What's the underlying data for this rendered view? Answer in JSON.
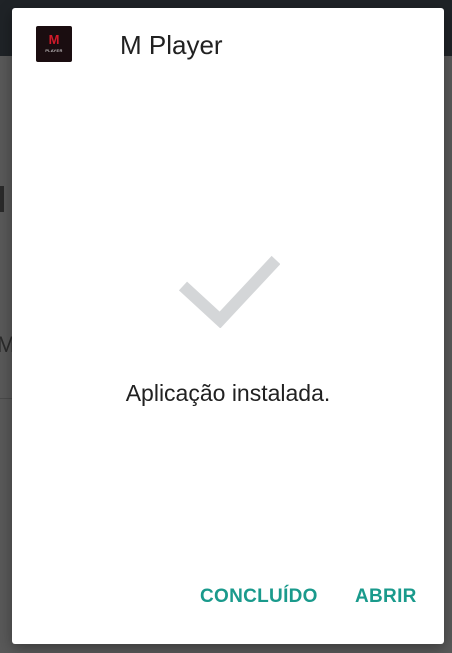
{
  "app": {
    "name": "M Player",
    "icon": {
      "name": "m-player-app-icon",
      "letter": "M",
      "sub_text": "PLAYER",
      "background": "#1a0d10",
      "accent": "#d11a2a"
    }
  },
  "status": {
    "icon": "checkmark-icon",
    "message": "Aplicação instalada."
  },
  "actions": {
    "done_label": "CONCLUÍDO",
    "open_label": "ABRIR"
  },
  "colors": {
    "accent": "#1a9a8c",
    "check": "#d4d6d8",
    "scrim": "#595959",
    "dialog": "#ffffff"
  }
}
